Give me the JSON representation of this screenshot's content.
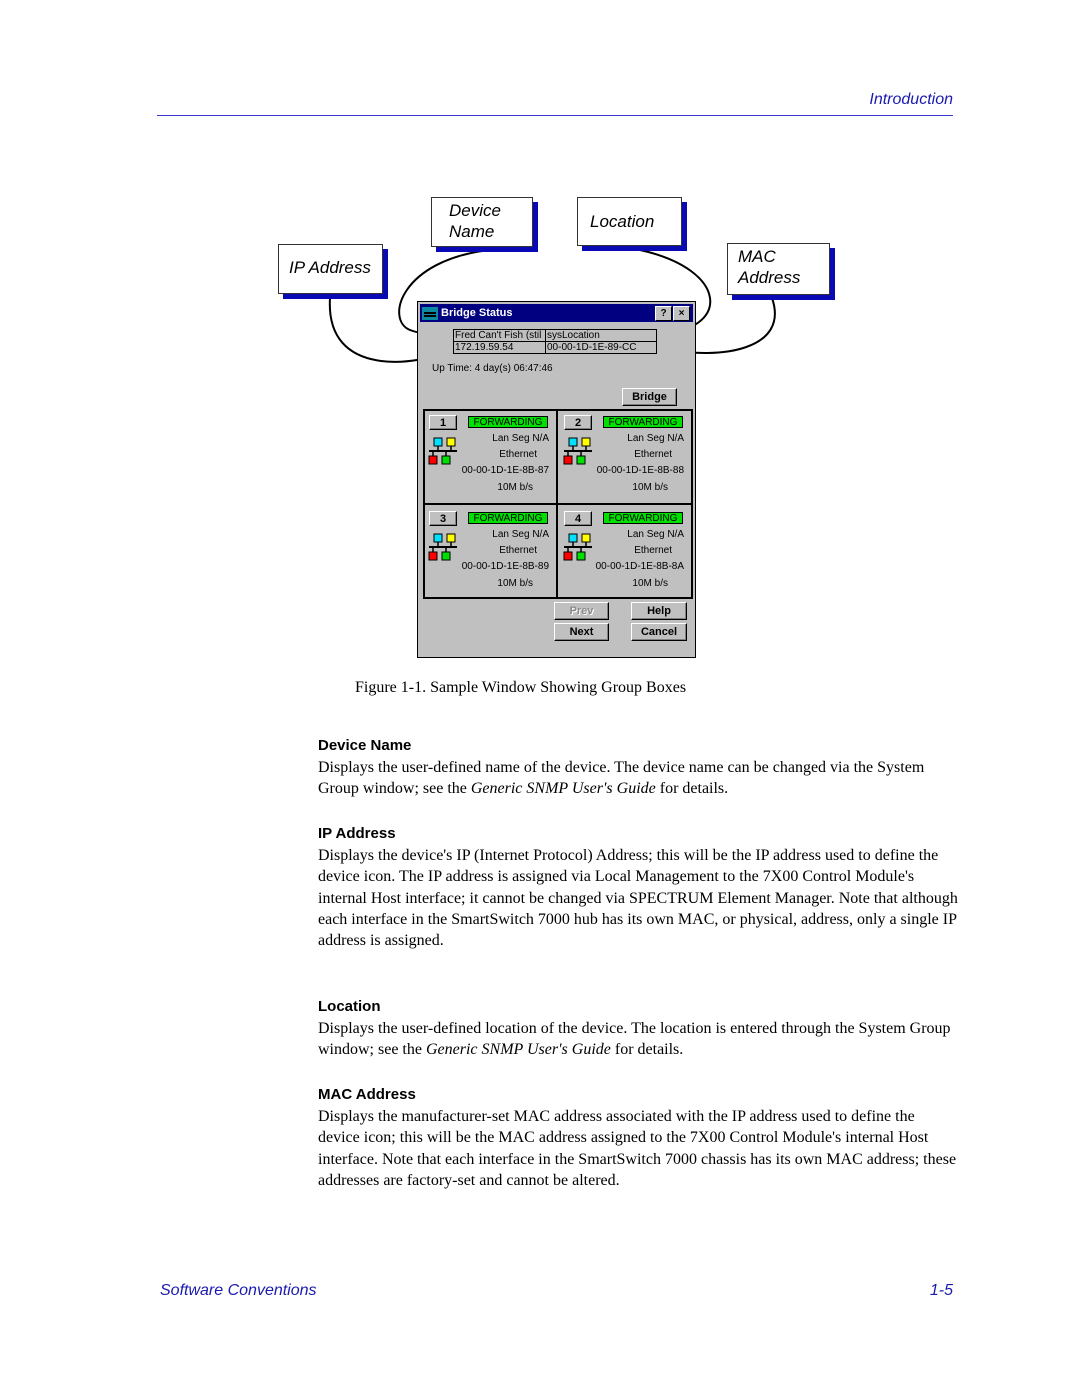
{
  "header": {
    "title": "Introduction"
  },
  "footer": {
    "left": "Software Conventions",
    "page": "1-5"
  },
  "figure": {
    "callouts": {
      "device_name_line1": "Device",
      "device_name_line2": "Name",
      "location": "Location",
      "ip_address": "IP Address",
      "mac_line1": "MAC",
      "mac_line2": "Address"
    },
    "window": {
      "title": "Bridge Status",
      "help_button": "?",
      "close_button": "×",
      "device_name": "Fred Can't Fish (stil",
      "location": "sysLocation",
      "ip_address": "172.19.59.54",
      "mac_address": "00-00-1D-1E-89-CC",
      "uptime": "Up Time: 4 day(s) 06:47:46",
      "bridge_button": "Bridge",
      "ports": [
        {
          "number": "1",
          "status": "FORWARDING",
          "segment": "Lan Seg N/A",
          "type": "Ethernet",
          "mac": "00-00-1D-1E-8B-87",
          "speed": "10M b/s"
        },
        {
          "number": "2",
          "status": "FORWARDING",
          "segment": "Lan Seg N/A",
          "type": "Ethernet",
          "mac": "00-00-1D-1E-8B-88",
          "speed": "10M b/s"
        },
        {
          "number": "3",
          "status": "FORWARDING",
          "segment": "Lan Seg N/A",
          "type": "Ethernet",
          "mac": "00-00-1D-1E-8B-89",
          "speed": "10M b/s"
        },
        {
          "number": "4",
          "status": "FORWARDING",
          "segment": "Lan Seg N/A",
          "type": "Ethernet",
          "mac": "00-00-1D-1E-8B-8A",
          "speed": "10M b/s"
        }
      ],
      "buttons": {
        "prev": "Prev",
        "help": "Help",
        "next": "Next",
        "cancel": "Cancel"
      },
      "colors": {
        "titlebar": "#000080",
        "forwarding": "#00e000",
        "window_bg": "#c0c0c0"
      }
    },
    "caption": "Figure 1-1.  Sample Window Showing Group Boxes"
  },
  "sections": [
    {
      "heading": "Device Name",
      "body_pre": "Displays the user-defined name of the device. The device name can be changed via the System Group window; see the ",
      "body_em": "Generic SNMP User's Guide",
      "body_post": " for details."
    },
    {
      "heading": "IP Address",
      "body_pre": "Displays the device's IP (Internet Protocol) Address; this will be the IP address used to define the device icon. The IP address is assigned via Local Management to the 7X00 Control Module's internal Host interface; it cannot be changed via SPECTRUM Element Manager. Note that although each interface in the SmartSwitch 7000 hub has its own MAC, or physical, address, only a single IP address is assigned.",
      "body_em": "",
      "body_post": ""
    },
    {
      "heading": "Location",
      "body_pre": "Displays the user-defined location of the device. The location is entered through the System Group window; see the ",
      "body_em": "Generic SNMP User's Guide",
      "body_post": " for details."
    },
    {
      "heading": "MAC Address",
      "body_pre": "Displays the manufacturer-set MAC address associated with the IP address used to define the device icon; this will be the MAC address assigned to the 7X00 Control Module's internal Host interface. Note that each interface in the SmartSwitch 7000 chassis has its own MAC address; these addresses are factory-set and cannot be altered.",
      "body_em": "",
      "body_post": ""
    }
  ]
}
